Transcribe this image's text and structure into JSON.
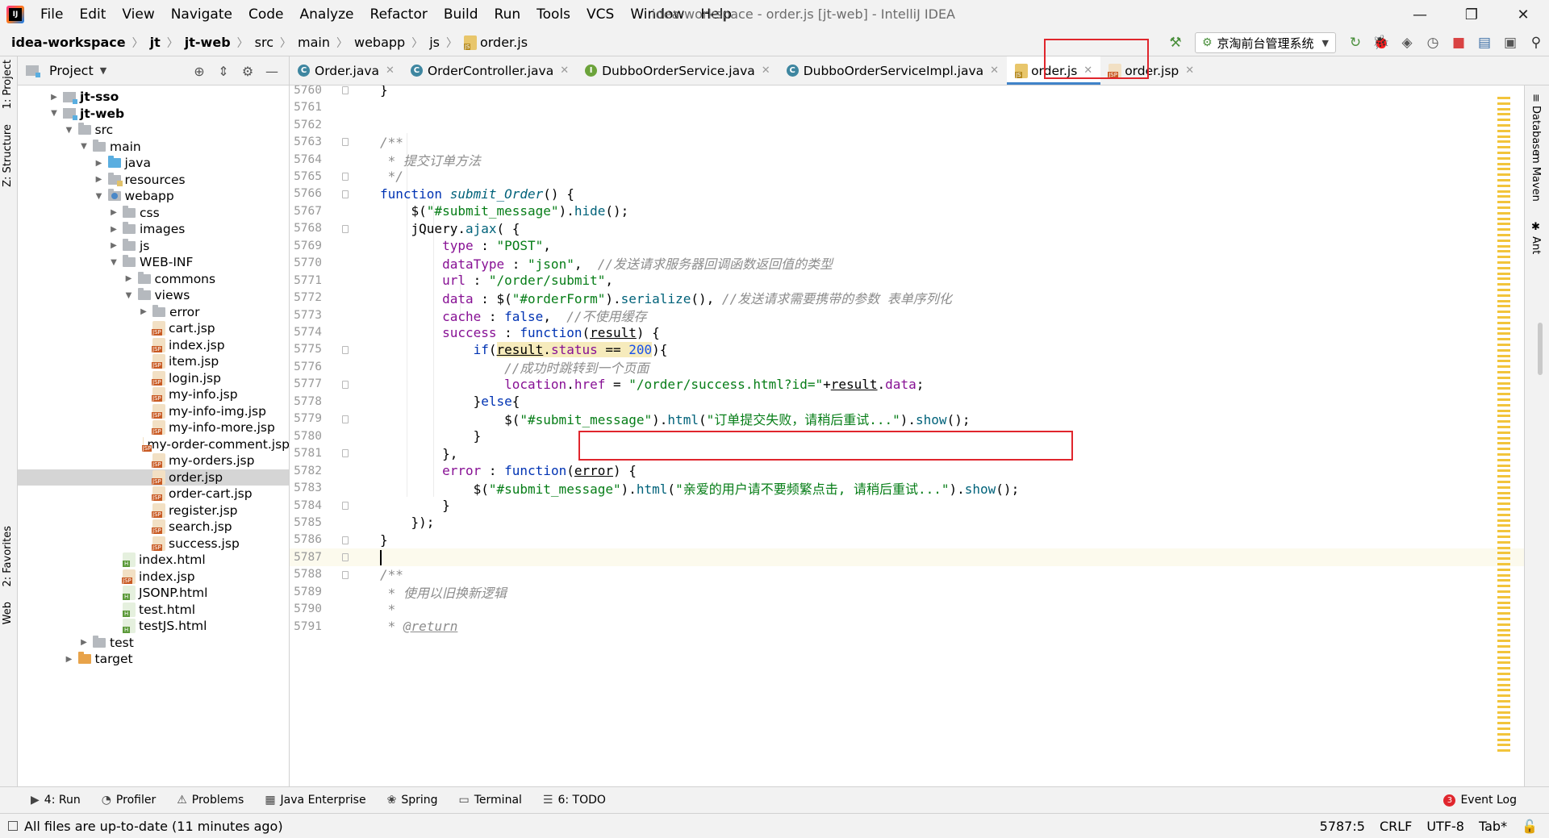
{
  "window": {
    "title": "idea-workspace - order.js [jt-web] - IntelliJ IDEA",
    "minimize": "—",
    "maximize": "❐",
    "close": "✕"
  },
  "menu": [
    "File",
    "Edit",
    "View",
    "Navigate",
    "Code",
    "Analyze",
    "Refactor",
    "Build",
    "Run",
    "Tools",
    "VCS",
    "Window",
    "Help"
  ],
  "breadcrumb": [
    "idea-workspace",
    "jt",
    "jt-web",
    "src",
    "main",
    "webapp",
    "js",
    "order.js"
  ],
  "run_config": {
    "label": "京淘前台管理系统"
  },
  "project_panel": {
    "title": "Project",
    "tree": [
      {
        "label": "jt-sso",
        "depth": 0,
        "kind": "module",
        "arrow": "▶",
        "bold": true
      },
      {
        "label": "jt-web",
        "depth": 0,
        "kind": "module",
        "arrow": "▼",
        "bold": true
      },
      {
        "label": "src",
        "depth": 1,
        "kind": "folder",
        "arrow": "▼"
      },
      {
        "label": "main",
        "depth": 2,
        "kind": "folder",
        "arrow": "▼"
      },
      {
        "label": "java",
        "depth": 3,
        "kind": "folder-blue",
        "arrow": "▶"
      },
      {
        "label": "resources",
        "depth": 3,
        "kind": "folder-res",
        "arrow": "▶"
      },
      {
        "label": "webapp",
        "depth": 3,
        "kind": "folder-web",
        "arrow": "▼"
      },
      {
        "label": "css",
        "depth": 4,
        "kind": "folder",
        "arrow": "▶"
      },
      {
        "label": "images",
        "depth": 4,
        "kind": "folder",
        "arrow": "▶"
      },
      {
        "label": "js",
        "depth": 4,
        "kind": "folder",
        "arrow": "▶"
      },
      {
        "label": "WEB-INF",
        "depth": 4,
        "kind": "folder",
        "arrow": "▼"
      },
      {
        "label": "commons",
        "depth": 5,
        "kind": "folder",
        "arrow": "▶"
      },
      {
        "label": "views",
        "depth": 5,
        "kind": "folder",
        "arrow": "▼"
      },
      {
        "label": "error",
        "depth": 6,
        "kind": "folder",
        "arrow": "▶"
      },
      {
        "label": "cart.jsp",
        "depth": 6,
        "kind": "jsp"
      },
      {
        "label": "index.jsp",
        "depth": 6,
        "kind": "jsp"
      },
      {
        "label": "item.jsp",
        "depth": 6,
        "kind": "jsp"
      },
      {
        "label": "login.jsp",
        "depth": 6,
        "kind": "jsp"
      },
      {
        "label": "my-info.jsp",
        "depth": 6,
        "kind": "jsp"
      },
      {
        "label": "my-info-img.jsp",
        "depth": 6,
        "kind": "jsp"
      },
      {
        "label": "my-info-more.jsp",
        "depth": 6,
        "kind": "jsp"
      },
      {
        "label": "my-order-comment.jsp",
        "depth": 6,
        "kind": "jsp"
      },
      {
        "label": "my-orders.jsp",
        "depth": 6,
        "kind": "jsp"
      },
      {
        "label": "order.jsp",
        "depth": 6,
        "kind": "jsp",
        "selected": true
      },
      {
        "label": "order-cart.jsp",
        "depth": 6,
        "kind": "jsp"
      },
      {
        "label": "register.jsp",
        "depth": 6,
        "kind": "jsp"
      },
      {
        "label": "search.jsp",
        "depth": 6,
        "kind": "jsp"
      },
      {
        "label": "success.jsp",
        "depth": 6,
        "kind": "jsp"
      },
      {
        "label": "index.html",
        "depth": 4,
        "kind": "html"
      },
      {
        "label": "index.jsp",
        "depth": 4,
        "kind": "jsp"
      },
      {
        "label": "JSONP.html",
        "depth": 4,
        "kind": "html"
      },
      {
        "label": "test.html",
        "depth": 4,
        "kind": "html"
      },
      {
        "label": "testJS.html",
        "depth": 4,
        "kind": "html"
      },
      {
        "label": "test",
        "depth": 2,
        "kind": "folder",
        "arrow": "▶"
      },
      {
        "label": "target",
        "depth": 1,
        "kind": "folder-orange",
        "arrow": "▶"
      }
    ]
  },
  "editor_tabs": [
    {
      "label": "Order.java",
      "icon": "class"
    },
    {
      "label": "OrderController.java",
      "icon": "class"
    },
    {
      "label": "DubboOrderService.java",
      "icon": "interface"
    },
    {
      "label": "DubboOrderServiceImpl.java",
      "icon": "class"
    },
    {
      "label": "order.js",
      "icon": "js",
      "active": true
    },
    {
      "label": "order.jsp",
      "icon": "jsp"
    }
  ],
  "code_lines": [
    {
      "n": "5760",
      "html": "<span>}</span>"
    },
    {
      "n": "5761",
      "html": ""
    },
    {
      "n": "5762",
      "html": ""
    },
    {
      "n": "5763",
      "html": "<span class=\"doc\">/**</span>"
    },
    {
      "n": "5764",
      "html": "<span class=\"doc\"> * 提交订单方法</span>"
    },
    {
      "n": "5765",
      "html": "<span class=\"doc\"> */</span>"
    },
    {
      "n": "5766",
      "html": "<span class=\"kw\">function</span> <span class=\"fn\">submit_Order</span>() {"
    },
    {
      "n": "5767",
      "html": "    $(<span class=\"str\">\"#submit_message\"</span>).<span class=\"meth\">hide</span>();"
    },
    {
      "n": "5768",
      "html": "    jQuery.<span class=\"meth\">ajax</span>( {"
    },
    {
      "n": "5769",
      "html": "        <span class=\"prop\">type</span> : <span class=\"str\">\"POST\"</span>,"
    },
    {
      "n": "5770",
      "html": "        <span class=\"prop\">dataType</span> : <span class=\"str\">\"json\"</span>,  <span class=\"cmt\">//发送请求服务器回调函数返回值的类型</span>"
    },
    {
      "n": "5771",
      "html": "        <span class=\"prop\">url</span> : <span class=\"str\">\"/order/submit\"</span>,"
    },
    {
      "n": "5772",
      "html": "        <span class=\"prop\">data</span> : $(<span class=\"str\">\"#orderForm\"</span>).<span class=\"meth\">serialize</span>(), <span class=\"cmt\">//发送请求需要携带的参数 表单序列化</span>"
    },
    {
      "n": "5773",
      "html": "        <span class=\"prop\">cache</span> : <span class=\"kw\">false</span>,  <span class=\"cmt\">//不使用缓存</span>"
    },
    {
      "n": "5774",
      "html": "        <span class=\"prop\">success</span> : <span class=\"kw\">function</span>(<span class=\"param\">result</span>) {"
    },
    {
      "n": "5775",
      "html": "            <span class=\"kw\">if</span>(<span class=\"hl\"><span class=\"param\">result</span>.<span class=\"prop\">status</span> == <span class=\"num\">200</span></span>){"
    },
    {
      "n": "5776",
      "html": "                <span class=\"cmt\">//成功时跳转到一个页面</span>"
    },
    {
      "n": "5777",
      "html": "                <span class=\"prop\">location</span>.<span class=\"prop\">href</span> = <span class=\"str\">\"/order/success.html?id=\"</span>+<span class=\"param\">result</span>.<span class=\"prop\">data</span>;"
    },
    {
      "n": "5778",
      "html": "            }<span class=\"kw\">else</span>{"
    },
    {
      "n": "5779",
      "html": "                $(<span class=\"str\">\"#submit_message\"</span>).<span class=\"meth\">html</span>(<span class=\"str\">\"订单提交失败，请稍后重试...\"</span>).<span class=\"meth\">show</span>();"
    },
    {
      "n": "5780",
      "html": "            }"
    },
    {
      "n": "5781",
      "html": "        },"
    },
    {
      "n": "5782",
      "html": "        <span class=\"prop\">error</span> : <span class=\"kw\">function</span>(<span class=\"param\">error</span>) {"
    },
    {
      "n": "5783",
      "html": "            $(<span class=\"str\">\"#submit_message\"</span>).<span class=\"meth\">html</span>(<span class=\"str\">\"亲爱的用户请不要频繁点击, 请稍后重试...\"</span>).<span class=\"meth\">show</span>();"
    },
    {
      "n": "5784",
      "html": "        }"
    },
    {
      "n": "5785",
      "html": "    });"
    },
    {
      "n": "5786",
      "html": "}"
    },
    {
      "n": "5787",
      "html": "<span class=\"caret-bar\"></span>",
      "current": true
    },
    {
      "n": "5788",
      "html": "<span class=\"doc\">/**</span>"
    },
    {
      "n": "5789",
      "html": "<span class=\"doc\"> * 使用以旧换新逻辑</span>"
    },
    {
      "n": "5790",
      "html": "<span class=\"doc\"> *</span>"
    },
    {
      "n": "5791",
      "html": "<span class=\"doc\"> * </span><span class=\"doctag\">@return</span>"
    }
  ],
  "right_tabs": [
    "Database",
    "Maven",
    "Ant"
  ],
  "left_tabs": [
    "1: Project",
    "Z: Structure",
    "2: Favorites",
    "Web"
  ],
  "bottom_tools": [
    {
      "label": "4: Run",
      "icon": "▶"
    },
    {
      "label": "Profiler",
      "icon": "◔"
    },
    {
      "label": "Problems",
      "icon": "⚠"
    },
    {
      "label": "Java Enterprise",
      "icon": "▦"
    },
    {
      "label": "Spring",
      "icon": "❀"
    },
    {
      "label": "Terminal",
      "icon": "▭"
    },
    {
      "label": "6: TODO",
      "icon": "☰"
    }
  ],
  "event_log": {
    "count": "3",
    "label": "Event Log"
  },
  "status": {
    "message": "All files are up-to-date (11 minutes ago)",
    "position": "5787:5",
    "line_sep": "CRLF",
    "encoding": "UTF-8",
    "indent": "Tab*"
  },
  "colors": {
    "accent": "#4083c9",
    "annotation": "#e0262d"
  }
}
